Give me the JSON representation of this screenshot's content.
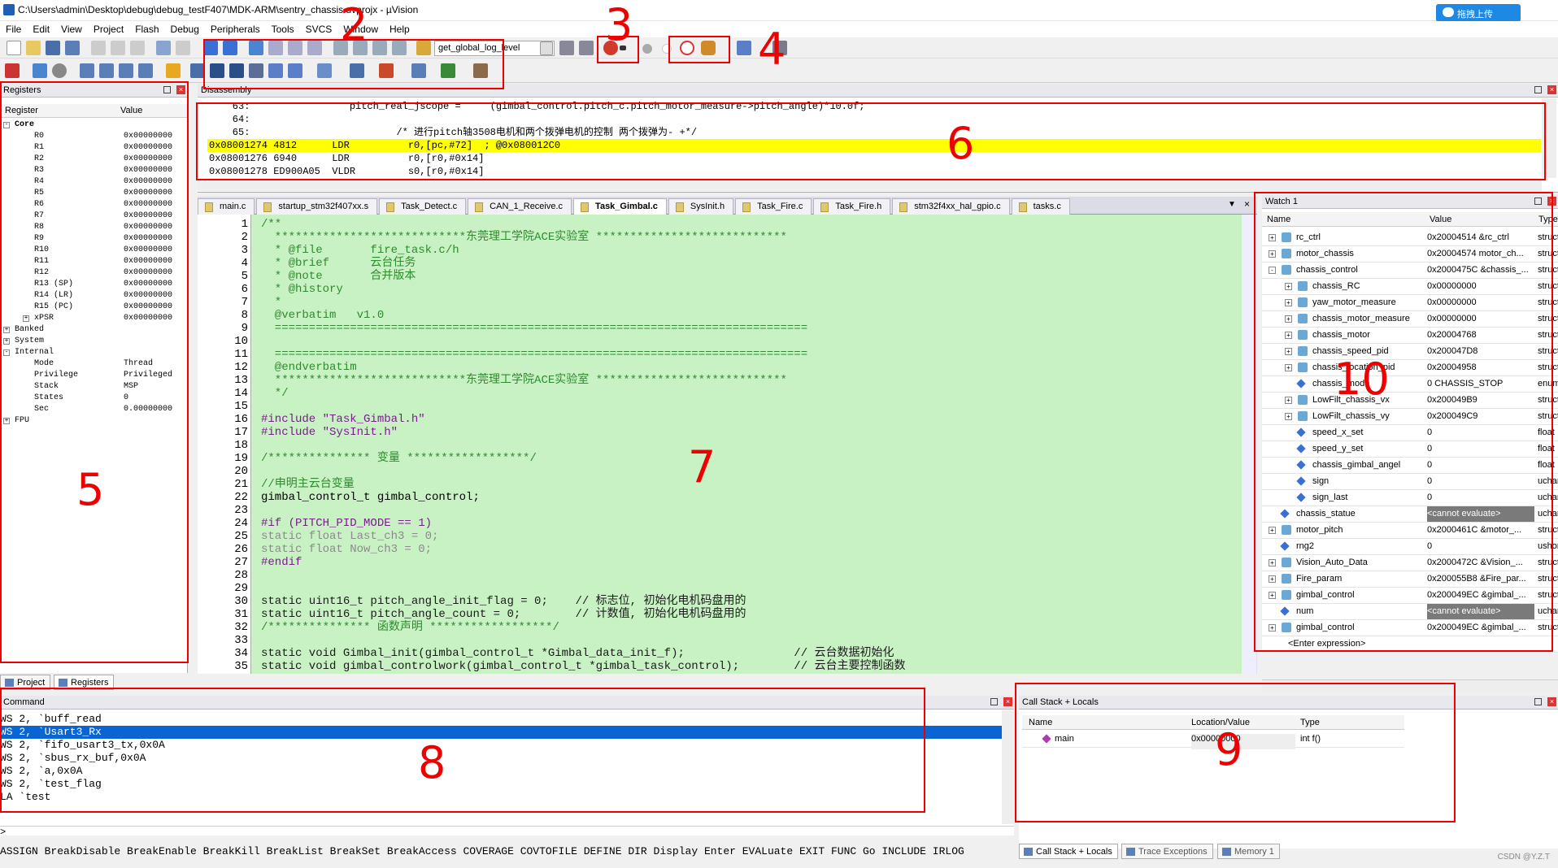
{
  "window": {
    "title": "C:\\Users\\admin\\Desktop\\debug\\debug_testF407\\MDK-ARM\\sentry_chassis.uvprojx - µVision",
    "upload_label": "拖拽上传"
  },
  "menu": [
    "File",
    "Edit",
    "View",
    "Project",
    "Flash",
    "Debug",
    "Peripherals",
    "Tools",
    "SVCS",
    "Window",
    "Help"
  ],
  "toolbar": {
    "function_combo": "get_global_log_level"
  },
  "registers": {
    "title": "Registers",
    "headers": [
      "Register",
      "Value"
    ],
    "rows": [
      {
        "name": "Core",
        "value": "",
        "indent": 0,
        "bold": true,
        "expand": "-"
      },
      {
        "name": "R0",
        "value": "0x00000000",
        "indent": 2
      },
      {
        "name": "R1",
        "value": "0x00000000",
        "indent": 2
      },
      {
        "name": "R2",
        "value": "0x00000000",
        "indent": 2
      },
      {
        "name": "R3",
        "value": "0x00000000",
        "indent": 2
      },
      {
        "name": "R4",
        "value": "0x00000000",
        "indent": 2
      },
      {
        "name": "R5",
        "value": "0x00000000",
        "indent": 2
      },
      {
        "name": "R6",
        "value": "0x00000000",
        "indent": 2
      },
      {
        "name": "R7",
        "value": "0x00000000",
        "indent": 2
      },
      {
        "name": "R8",
        "value": "0x00000000",
        "indent": 2
      },
      {
        "name": "R9",
        "value": "0x00000000",
        "indent": 2
      },
      {
        "name": "R10",
        "value": "0x00000000",
        "indent": 2
      },
      {
        "name": "R11",
        "value": "0x00000000",
        "indent": 2
      },
      {
        "name": "R12",
        "value": "0x00000000",
        "indent": 2
      },
      {
        "name": "R13 (SP)",
        "value": "0x00000000",
        "indent": 2
      },
      {
        "name": "R14 (LR)",
        "value": "0x00000000",
        "indent": 2
      },
      {
        "name": "R15 (PC)",
        "value": "0x00000000",
        "indent": 2
      },
      {
        "name": "xPSR",
        "value": "0x00000000",
        "indent": 2,
        "expand": "+"
      },
      {
        "name": "Banked",
        "value": "",
        "indent": 0,
        "expand": "+"
      },
      {
        "name": "System",
        "value": "",
        "indent": 0,
        "expand": "+"
      },
      {
        "name": "Internal",
        "value": "",
        "indent": 0,
        "expand": "-"
      },
      {
        "name": "Mode",
        "value": "Thread",
        "indent": 2
      },
      {
        "name": "Privilege",
        "value": "Privileged",
        "indent": 2
      },
      {
        "name": "Stack",
        "value": "MSP",
        "indent": 2
      },
      {
        "name": "States",
        "value": "0",
        "indent": 2
      },
      {
        "name": "Sec",
        "value": "0.00000000",
        "indent": 2
      },
      {
        "name": "FPU",
        "value": "",
        "indent": 0,
        "expand": "+"
      }
    ],
    "tabs": [
      "Project",
      "Registers"
    ]
  },
  "disassembly": {
    "title": "Disassembly",
    "lines": [
      {
        "text": "    63:                 pitch_real_jscope =     (gimbal_control.pitch_c.pitch_motor_measure->pitch_angle)*10.0f;",
        "hl": false
      },
      {
        "text": "    64:",
        "hl": false
      },
      {
        "text": "    65:                         /* 进行pitch轴3508电机和两个拨弹电机的控制 两个拨弹为- +*/",
        "hl": false
      },
      {
        "text": "0x08001274 4812      LDR          r0,[pc,#72]  ; @0x080012C0",
        "hl": true
      },
      {
        "text": "0x08001276 6940      LDR          r0,[r0,#0x14]",
        "hl": false
      },
      {
        "text": "0x08001278 ED900A05  VLDR         s0,[r0,#0x14]",
        "hl": false
      }
    ]
  },
  "tabs": [
    "main.c",
    "startup_stm32f407xx.s",
    "Task_Detect.c",
    "CAN_1_Receive.c",
    "Task_Gimbal.c",
    "SysInit.h",
    "Task_Fire.c",
    "Task_Fire.h",
    "stm32f4xx_hal_gpio.c",
    "tasks.c"
  ],
  "active_tab": 4,
  "code": [
    {
      "n": "1",
      "t": "/**",
      "c": "cmt"
    },
    {
      "n": "2",
      "t": "  ****************************东莞理工学院ACE实验室 ****************************",
      "c": "cmt"
    },
    {
      "n": "3",
      "t": "  * @file       fire_task.c/h",
      "c": "cmt"
    },
    {
      "n": "4",
      "t": "  * @brief      云台任务",
      "c": "cmt"
    },
    {
      "n": "5",
      "t": "  * @note       合并版本",
      "c": "cmt"
    },
    {
      "n": "6",
      "t": "  * @history",
      "c": "cmt"
    },
    {
      "n": "7",
      "t": "  *",
      "c": "cmt"
    },
    {
      "n": "8",
      "t": "  @verbatim   v1.0",
      "c": "cmt"
    },
    {
      "n": "9",
      "t": "  ==============================================================================",
      "c": "cmt"
    },
    {
      "n": "10",
      "t": "",
      "c": ""
    },
    {
      "n": "11",
      "t": "  ==============================================================================",
      "c": "cmt"
    },
    {
      "n": "12",
      "t": "  @endverbatim",
      "c": "cmt"
    },
    {
      "n": "13",
      "t": "  ****************************东莞理工学院ACE实验室 ****************************",
      "c": "cmt"
    },
    {
      "n": "14",
      "t": "  */",
      "c": "cmt"
    },
    {
      "n": "15",
      "t": "",
      "c": ""
    },
    {
      "n": "16",
      "t": "#include \"Task_Gimbal.h\"",
      "c": "pp"
    },
    {
      "n": "17",
      "t": "#include \"SysInit.h\"",
      "c": "pp"
    },
    {
      "n": "18",
      "t": "",
      "c": ""
    },
    {
      "n": "19",
      "t": "/*************** 变量 ******************/",
      "c": "cmt"
    },
    {
      "n": "20",
      "t": "",
      "c": ""
    },
    {
      "n": "21",
      "t": "//申明主云台变量",
      "c": "cmt"
    },
    {
      "n": "22",
      "t": "gimbal_control_t gimbal_control;",
      "c": ""
    },
    {
      "n": "23",
      "t": "",
      "c": ""
    },
    {
      "n": "24",
      "t": "#if (PITCH_PID_MODE == 1)",
      "c": "pp"
    },
    {
      "n": "25",
      "t": "static float Last_ch3 = 0;",
      "c": "gry"
    },
    {
      "n": "26",
      "t": "static float Now_ch3 = 0;",
      "c": "gry"
    },
    {
      "n": "27",
      "t": "#endif",
      "c": "pp"
    },
    {
      "n": "28",
      "t": "",
      "c": ""
    },
    {
      "n": "29",
      "t": "",
      "c": ""
    },
    {
      "n": "30",
      "t": "static uint16_t pitch_angle_init_flag = 0;    // 标志位, 初始化电机码盘用的",
      "c": "mix"
    },
    {
      "n": "31",
      "t": "static uint16_t pitch_angle_count = 0;        // 计数值, 初始化电机码盘用的",
      "c": "mix"
    },
    {
      "n": "32",
      "t": "/*************** 函数声明 ******************/",
      "c": "cmt"
    },
    {
      "n": "33",
      "t": "",
      "c": ""
    },
    {
      "n": "34",
      "t": "static void Gimbal_init(gimbal_control_t *Gimbal_data_init_f);                // 云台数据初始化",
      "c": "mix"
    },
    {
      "n": "35",
      "t": "static void gimbal_controlwork(gimbal_control_t *gimbal_task_control);        // 云台主要控制函数",
      "c": "mix"
    }
  ],
  "watch": {
    "title": "Watch 1",
    "headers": [
      "Name",
      "Value",
      "Type"
    ],
    "rows": [
      {
        "name": "rc_ctrl",
        "value": "0x20004514 &rc_ctrl",
        "type": "struct",
        "lvl": 0,
        "exp": "+",
        "icon": "g"
      },
      {
        "name": "motor_chassis",
        "value": "0x20004574 motor_ch...",
        "type": "struct",
        "lvl": 0,
        "exp": "+",
        "icon": "g"
      },
      {
        "name": "chassis_control",
        "value": "0x2000475C &chassis_...",
        "type": "struct",
        "lvl": 0,
        "exp": "-",
        "icon": "g"
      },
      {
        "name": "chassis_RC",
        "value": "0x00000000",
        "type": "struct",
        "lvl": 1,
        "exp": "+",
        "icon": "g"
      },
      {
        "name": "yaw_motor_measure",
        "value": "0x00000000",
        "type": "struct",
        "lvl": 1,
        "exp": "+",
        "icon": "g"
      },
      {
        "name": "chassis_motor_measure",
        "value": "0x00000000",
        "type": "struct",
        "lvl": 1,
        "exp": "+",
        "icon": "g"
      },
      {
        "name": "chassis_motor",
        "value": "0x20004768",
        "type": "struct",
        "lvl": 1,
        "exp": "+",
        "icon": "g"
      },
      {
        "name": "chassis_speed_pid",
        "value": "0x200047D8",
        "type": "struct",
        "lvl": 1,
        "exp": "+",
        "icon": "g"
      },
      {
        "name": "chassis_location_pid",
        "value": "0x20004958",
        "type": "struct",
        "lvl": 1,
        "exp": "+",
        "icon": "g"
      },
      {
        "name": "chassis_mode",
        "value": "0 CHASSIS_STOP",
        "type": "enum",
        "lvl": 1,
        "exp": "",
        "icon": "d"
      },
      {
        "name": "LowFilt_chassis_vx",
        "value": "0x200049B9",
        "type": "struct",
        "lvl": 1,
        "exp": "+",
        "icon": "g"
      },
      {
        "name": "LowFilt_chassis_vy",
        "value": "0x200049C9",
        "type": "struct",
        "lvl": 1,
        "exp": "+",
        "icon": "g"
      },
      {
        "name": "speed_x_set",
        "value": "0",
        "type": "float",
        "lvl": 1,
        "exp": "",
        "icon": "d"
      },
      {
        "name": "speed_y_set",
        "value": "0",
        "type": "float",
        "lvl": 1,
        "exp": "",
        "icon": "d"
      },
      {
        "name": "chassis_gimbal_angel",
        "value": "0",
        "type": "float",
        "lvl": 1,
        "exp": "",
        "icon": "d"
      },
      {
        "name": "sign",
        "value": "0",
        "type": "uchar",
        "lvl": 1,
        "exp": "",
        "icon": "d"
      },
      {
        "name": "sign_last",
        "value": "0",
        "type": "uchar",
        "lvl": 1,
        "exp": "",
        "icon": "d"
      },
      {
        "name": "chassis_statue",
        "value": "<cannot evaluate>",
        "type": "uchar",
        "lvl": 0,
        "exp": "",
        "icon": "d",
        "err": true
      },
      {
        "name": "motor_pitch",
        "value": "0x2000461C &motor_...",
        "type": "struct",
        "lvl": 0,
        "exp": "+",
        "icon": "g"
      },
      {
        "name": "rng2",
        "value": "0",
        "type": "ushort",
        "lvl": 0,
        "exp": "",
        "icon": "d"
      },
      {
        "name": "Vision_Auto_Data",
        "value": "0x2000472C &Vision_...",
        "type": "struct",
        "lvl": 0,
        "exp": "+",
        "icon": "g"
      },
      {
        "name": "Fire_param",
        "value": "0x200055B8 &Fire_par...",
        "type": "struct",
        "lvl": 0,
        "exp": "+",
        "icon": "g"
      },
      {
        "name": "gimbal_control",
        "value": "0x200049EC &gimbal_...",
        "type": "struct",
        "lvl": 0,
        "exp": "+",
        "icon": "g"
      },
      {
        "name": "num",
        "value": "<cannot evaluate>",
        "type": "uchar",
        "lvl": 0,
        "exp": "",
        "icon": "d",
        "err": true
      },
      {
        "name": "gimbal_control",
        "value": "0x200049EC &gimbal_...",
        "type": "struct",
        "lvl": 0,
        "exp": "+",
        "icon": "g"
      },
      {
        "name": "<Enter expression>",
        "value": "",
        "type": "",
        "lvl": 0,
        "exp": "",
        "icon": ""
      }
    ]
  },
  "command": {
    "title": "Command",
    "lines": [
      {
        "t": "WS 2, `buff_read",
        "sel": false
      },
      {
        "t": "WS 2, `Usart3_Rx",
        "sel": true
      },
      {
        "t": "WS 2, `fifo_usart3_tx,0x0A",
        "sel": false
      },
      {
        "t": "WS 2, `sbus_rx_buf,0x0A",
        "sel": false
      },
      {
        "t": "WS 2, `a,0x0A",
        "sel": false
      },
      {
        "t": "WS 2, `test_flag",
        "sel": false
      },
      {
        "t": "LA `test",
        "sel": false
      }
    ],
    "prompt": ">",
    "hints": "ASSIGN BreakDisable BreakEnable BreakKill BreakList BreakSet BreakAccess COVERAGE COVTOFILE DEFINE DIR Display Enter EVALuate EXIT FUNC Go INCLUDE IRLOG"
  },
  "callstack": {
    "title": "Call Stack + Locals",
    "headers": [
      "Name",
      "Location/Value",
      "Type"
    ],
    "rows": [
      {
        "name": "main",
        "value": "0x00000000",
        "type": "int f()"
      }
    ],
    "tabs": [
      "Call Stack + Locals",
      "Trace Exceptions",
      "Memory 1"
    ]
  },
  "watermark": "CSDN @Y.Z.T",
  "annotations": [
    "2",
    "3",
    "4",
    "5",
    "6",
    "7",
    "8",
    "9",
    "10"
  ]
}
